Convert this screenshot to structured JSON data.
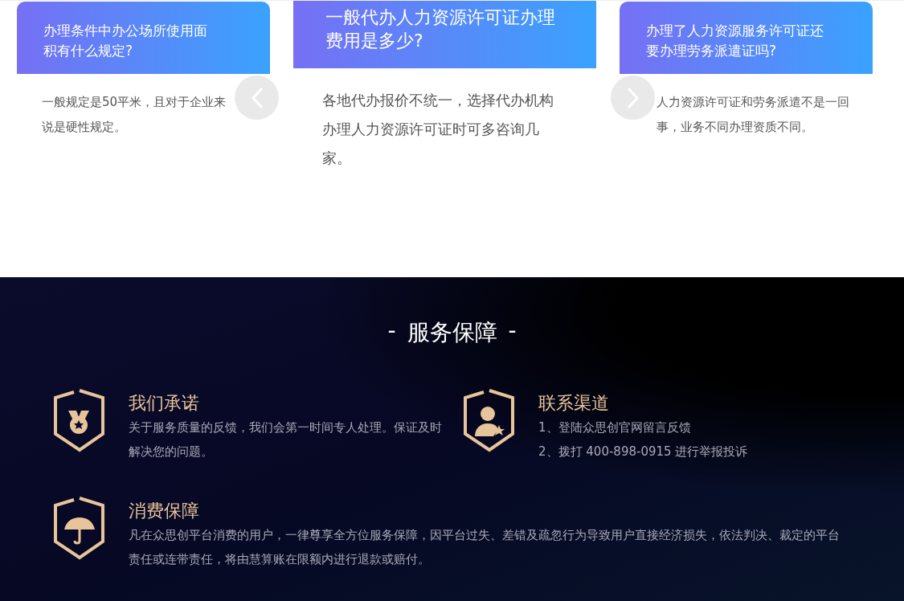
{
  "faq_cards": [
    {
      "question": "办理条件中办公场所使用面积有什么规定?",
      "answer": "一般规定是50平米，且对于企业来说是硬性规定。",
      "selected": false
    },
    {
      "question": "一般代办人力资源许可证办理费用是多少?",
      "answer": "各地代办报价不统一，选择代办机构办理人力资源许可证时可多咨询几家。",
      "selected": true
    },
    {
      "question": "办理了人力资源服务许可证还要办理劳务派遣证吗?",
      "answer": "人力资源许可证和劳务派遣不是一回事，业务不同办理资质不同。",
      "selected": false
    }
  ],
  "service": {
    "title": "服务保障",
    "dash": "-",
    "items": [
      {
        "title": "我们承诺",
        "lines": [
          "关于服务质量的反馈，我们会第一时间专人处理。保证及时解决您的问题。"
        ]
      },
      {
        "title": "联系渠道",
        "lines": [
          "1、登陆众思创官网留言反馈",
          "2、拨打 400-898-0915 进行举报投诉"
        ]
      },
      {
        "title": "消费保障",
        "lines": [
          "凡在众思创平台消费的用户，一律尊享全方位服务保障，因平台过失、差错及疏忽行为导致用户直接经济损失，依法判决、裁定的平台责任或连带责任，将由慧算账在限额内进行退款或赔付。"
        ]
      }
    ]
  }
}
